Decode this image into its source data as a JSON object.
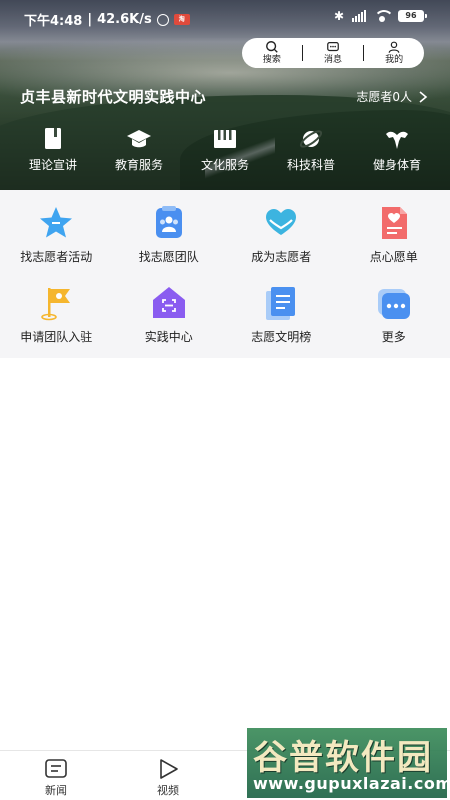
{
  "status_bar": {
    "time": "下午4:48",
    "speed": "42.6K/s",
    "app_badge": "淘",
    "battery": "96"
  },
  "top_actions": {
    "search": "搜索",
    "messages": "消息",
    "mine": "我的"
  },
  "header": {
    "title": "贞丰县新时代文明实践中心",
    "volunteer_count": "志愿者0人"
  },
  "categories": [
    {
      "label": "理论宣讲",
      "icon": "book-icon"
    },
    {
      "label": "教育服务",
      "icon": "graduation-cap-icon"
    },
    {
      "label": "文化服务",
      "icon": "piano-icon"
    },
    {
      "label": "科技科普",
      "icon": "planet-icon"
    },
    {
      "label": "健身体育",
      "icon": "muscle-icon"
    }
  ],
  "services": [
    {
      "label": "找志愿者活动",
      "icon": "star-icon",
      "color": "#3fa4f0"
    },
    {
      "label": "找志愿团队",
      "icon": "team-icon",
      "color": "#4a8ff0"
    },
    {
      "label": "成为志愿者",
      "icon": "heart-hands-icon",
      "color": "#3cb4e0"
    },
    {
      "label": "点心愿单",
      "icon": "wish-list-icon",
      "color": "#f26b6b"
    },
    {
      "label": "申请团队入驻",
      "icon": "flag-icon",
      "color": "#f5b62e"
    },
    {
      "label": "实践中心",
      "icon": "home-scan-icon",
      "color": "#8a5cf0"
    },
    {
      "label": "志愿文明榜",
      "icon": "document-icon",
      "color": "#4a90f0"
    },
    {
      "label": "更多",
      "icon": "more-icon",
      "color": "#4a90f0"
    }
  ],
  "bottom_nav": [
    {
      "label": "新闻",
      "icon": "news-icon"
    },
    {
      "label": "视频",
      "icon": "video-icon"
    }
  ],
  "watermark": {
    "title": "谷普软件园",
    "url": "www.gupuxlazai.com"
  }
}
